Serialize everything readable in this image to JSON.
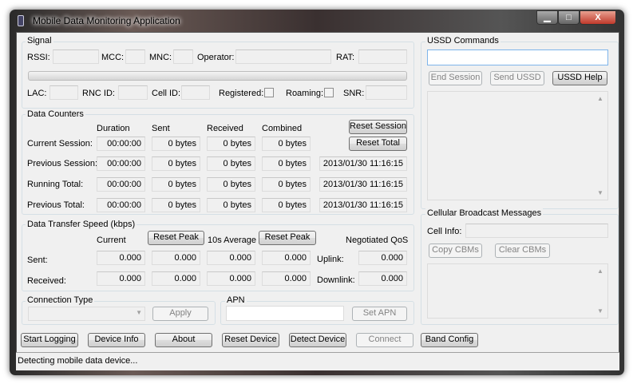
{
  "window": {
    "title": "Mobile Data Monitoring Application",
    "minimize": "▁",
    "maximize": "□",
    "close": "X",
    "icon": "phone-icon"
  },
  "signal": {
    "label": "Signal",
    "rssi": "RSSI:",
    "mcc": "MCC:",
    "mnc": "MNC:",
    "operator": "Operator:",
    "rat": "RAT:",
    "lac": "LAC:",
    "rnc_id": "RNC ID:",
    "cell_id": "Cell ID:",
    "registered": "Registered:",
    "roaming": "Roaming:",
    "snr": "SNR:",
    "signal_level": 0
  },
  "counters": {
    "label": "Data Counters",
    "headers": [
      "Duration",
      "Sent",
      "Received",
      "Combined"
    ],
    "reset_session": "Reset Session",
    "reset_total": "Reset Total",
    "rows": [
      {
        "label": "Current Session:",
        "duration": "00:00:00",
        "sent": "0 bytes",
        "received": "0 bytes",
        "combined": "0 bytes",
        "time": ""
      },
      {
        "label": "Previous Session:",
        "duration": "00:00:00",
        "sent": "0 bytes",
        "received": "0 bytes",
        "combined": "0 bytes",
        "time": "2013/01/30 11:16:15"
      },
      {
        "label": "Running Total:",
        "duration": "00:00:00",
        "sent": "0 bytes",
        "received": "0 bytes",
        "combined": "0 bytes",
        "time": "2013/01/30 11:16:15"
      },
      {
        "label": "Previous Total:",
        "duration": "00:00:00",
        "sent": "0 bytes",
        "received": "0 bytes",
        "combined": "0 bytes",
        "time": "2013/01/30 11:16:15"
      }
    ]
  },
  "speed": {
    "label": "Data Transfer Speed (kbps)",
    "current": "Current",
    "reset_peak": "Reset Peak",
    "avg": "10s Average",
    "qos": "Negotiated QoS",
    "uplink": "Uplink:",
    "downlink": "Downlink:",
    "rows": [
      {
        "label": "Sent:",
        "v": [
          "0.000",
          "0.000",
          "0.000",
          "0.000"
        ],
        "qos": "0.000"
      },
      {
        "label": "Received:",
        "v": [
          "0.000",
          "0.000",
          "0.000",
          "0.000"
        ],
        "qos": "0.000"
      }
    ]
  },
  "conn": {
    "label": "Connection Type",
    "value": "",
    "apply": "Apply"
  },
  "apn": {
    "label": "APN",
    "value": "",
    "set": "Set APN"
  },
  "ussd": {
    "label": "USSD Commands",
    "value": "",
    "end": "End Session",
    "send": "Send USSD",
    "help": "USSD Help"
  },
  "cbm": {
    "label": "Cellular Broadcast Messages",
    "cell_info": "Cell Info:",
    "copy": "Copy CBMs",
    "clear": "Clear CBMs"
  },
  "buttons": [
    "Start Logging",
    "Device Info",
    "About",
    "Reset Device",
    "Detect Device",
    "Connect",
    "Band Config"
  ],
  "status": "Detecting mobile data device..."
}
